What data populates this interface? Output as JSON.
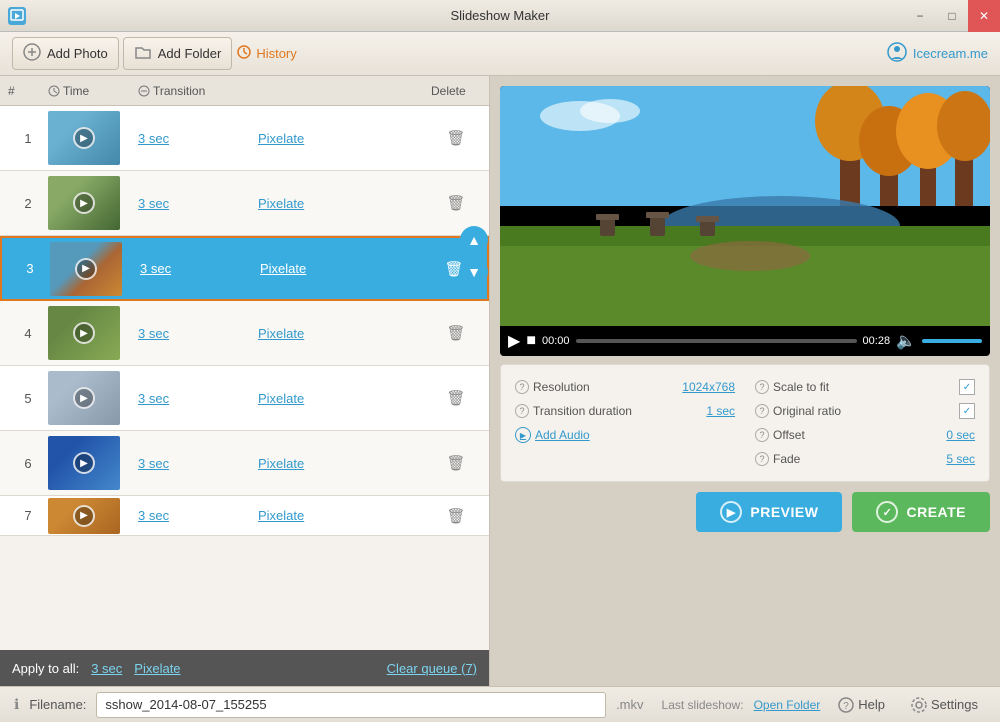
{
  "app": {
    "title": "Slideshow Maker",
    "icon": "S"
  },
  "titlebar": {
    "minimize": "−",
    "maximize": "□",
    "close": "✕"
  },
  "toolbar": {
    "add_photo": "Add Photo",
    "add_folder": "Add Folder",
    "history": "History",
    "icecream": "Icecream.me"
  },
  "slide_list": {
    "headers": {
      "num": "#",
      "time": "Time",
      "transition": "Transition",
      "delete": "Delete"
    },
    "slides": [
      {
        "num": "1",
        "time": "3 sec",
        "transition": "Pixelate",
        "selected": false
      },
      {
        "num": "2",
        "time": "3 sec",
        "transition": "Pixelate",
        "selected": false
      },
      {
        "num": "3",
        "time": "3 sec",
        "transition": "Pixelate",
        "selected": true
      },
      {
        "num": "4",
        "time": "3 sec",
        "transition": "Pixelate",
        "selected": false
      },
      {
        "num": "5",
        "time": "3 sec",
        "transition": "Pixelate",
        "selected": false
      },
      {
        "num": "6",
        "time": "3 sec",
        "transition": "Pixelate",
        "selected": false
      },
      {
        "num": "7",
        "time": "3 sec",
        "transition": "Pixelate",
        "selected": false
      }
    ],
    "apply_all_label": "Apply to all:",
    "apply_all_time": "3 sec",
    "apply_all_transition": "Pixelate",
    "clear_queue": "Clear queue (7)"
  },
  "video": {
    "current_time": "00:00",
    "total_time": "00:28"
  },
  "settings": {
    "resolution_label": "Resolution",
    "resolution_value": "1024x768",
    "transition_duration_label": "Transition duration",
    "transition_duration_value": "1 sec",
    "add_audio_label": "Add Audio",
    "scale_to_fit_label": "Scale to fit",
    "original_ratio_label": "Original ratio",
    "offset_label": "Offset",
    "offset_value": "0 sec",
    "fade_label": "Fade",
    "fade_value": "5 sec"
  },
  "bottom": {
    "filename_label": "Filename:",
    "filename_value": "sshow_2014-08-07_155255",
    "ext": ".mkv",
    "last_slideshow_label": "Last slideshow:",
    "open_folder_label": "Open Folder"
  },
  "actions": {
    "preview_label": "PREVIEW",
    "create_label": "CREATE",
    "help_label": "Help",
    "settings_label": "Settings"
  }
}
